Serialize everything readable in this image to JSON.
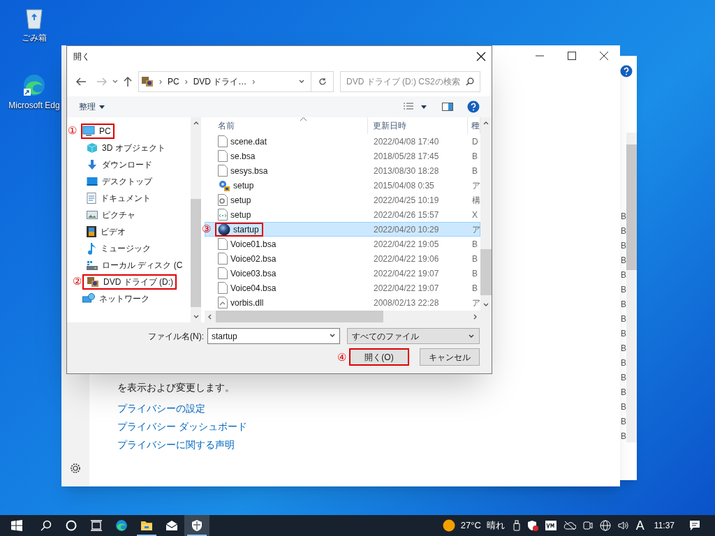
{
  "desktop_icons": [
    {
      "label": "ごみ箱",
      "kind": "bin"
    },
    {
      "label": "Microsoft Edg",
      "kind": "edge"
    }
  ],
  "back_window": {
    "size_cells": [
      "B",
      "B",
      "B",
      "B",
      "B",
      "B",
      "B",
      "B",
      "B",
      "B",
      "B",
      "B",
      "B",
      "B",
      "B",
      "B"
    ]
  },
  "settings_window": {
    "description": "を表示および変更します。",
    "links": [
      "プライバシーの設定",
      "プライバシー ダッシュボード",
      "プライバシーに関する声明"
    ]
  },
  "dialog": {
    "title": "開く",
    "address": {
      "crumbs": [
        "PC",
        "DVD ドライ…"
      ],
      "separators": [
        "›",
        "›",
        "›"
      ]
    },
    "search": {
      "placeholder": "DVD ドライブ (D:) CS2の検索"
    },
    "organize": "整理",
    "nav_items": [
      {
        "label": "PC",
        "kind": "pc",
        "selected": false,
        "callout": "①",
        "children": [
          {
            "label": "3D オブジェクト",
            "kind": "cube",
            "selected": false
          },
          {
            "label": "ダウンロード",
            "kind": "download",
            "selected": false
          },
          {
            "label": "デスクトップ",
            "kind": "desktop",
            "selected": false
          },
          {
            "label": "ドキュメント",
            "kind": "document",
            "selected": false
          },
          {
            "label": "ピクチャ",
            "kind": "picture",
            "selected": false
          },
          {
            "label": "ビデオ",
            "kind": "film",
            "selected": false
          },
          {
            "label": "ミュージック",
            "kind": "music",
            "selected": false
          },
          {
            "label": "ローカル ディスク (C",
            "kind": "disk",
            "selected": false
          },
          {
            "label": "DVD ドライブ (D:)",
            "kind": "dvd",
            "selected": false,
            "callout": "②"
          }
        ]
      },
      {
        "label": "ネットワーク",
        "kind": "network",
        "selected": false
      }
    ],
    "columns": [
      "名前",
      "更新日時",
      "種"
    ],
    "files": [
      {
        "name": "scene.dat",
        "modified": "2022/04/08 17:40",
        "type": "D",
        "kind": "file",
        "selected": false
      },
      {
        "name": "se.bsa",
        "modified": "2018/05/28 17:45",
        "type": "B",
        "kind": "file",
        "selected": false
      },
      {
        "name": "sesys.bsa",
        "modified": "2013/08/30 18:28",
        "type": "B",
        "kind": "file",
        "selected": false
      },
      {
        "name": "setup",
        "modified": "2015/04/08 0:35",
        "type": "ア",
        "kind": "installer",
        "selected": false
      },
      {
        "name": "setup",
        "modified": "2022/04/25 10:19",
        "type": "構",
        "kind": "config",
        "selected": false
      },
      {
        "name": "setup",
        "modified": "2022/04/26 15:57",
        "type": "X",
        "kind": "xml",
        "selected": false
      },
      {
        "name": "startup",
        "modified": "2022/04/20 10:29",
        "type": "ア",
        "kind": "sphere",
        "selected": true,
        "callout": "③"
      },
      {
        "name": "Voice01.bsa",
        "modified": "2022/04/22 19:05",
        "type": "B",
        "kind": "file",
        "selected": false
      },
      {
        "name": "Voice02.bsa",
        "modified": "2022/04/22 19:06",
        "type": "B",
        "kind": "file",
        "selected": false
      },
      {
        "name": "Voice03.bsa",
        "modified": "2022/04/22 19:07",
        "type": "B",
        "kind": "file",
        "selected": false
      },
      {
        "name": "Voice04.bsa",
        "modified": "2022/04/22 19:07",
        "type": "B",
        "kind": "file",
        "selected": false
      },
      {
        "name": "vorbis.dll",
        "modified": "2008/02/13 22:28",
        "type": "ア",
        "kind": "dll",
        "selected": false
      }
    ],
    "filename_label": "ファイル名(N):",
    "filename": "startup",
    "filter": "すべてのファイル",
    "open_button": {
      "label": "開く(O)",
      "callout": "④"
    },
    "cancel_button": "キャンセル"
  },
  "taskbar": {
    "apps": [
      {
        "kind": "search",
        "running": false,
        "selected": false
      },
      {
        "kind": "cortana",
        "running": false,
        "selected": false
      },
      {
        "kind": "taskview",
        "running": false,
        "selected": false
      },
      {
        "kind": "edge",
        "running": false,
        "selected": false
      },
      {
        "kind": "folder",
        "running": true,
        "selected": false
      },
      {
        "kind": "mail",
        "running": false,
        "selected": false
      },
      {
        "kind": "shield",
        "running": true,
        "selected": true
      }
    ],
    "temperature": "27°C",
    "weather": "晴れ",
    "ime": "A",
    "time": "11:37"
  }
}
